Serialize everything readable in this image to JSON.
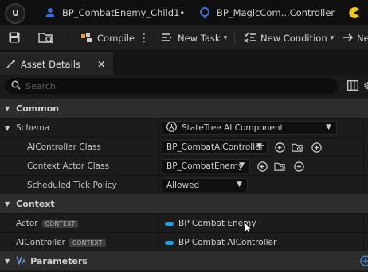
{
  "tabs": [
    {
      "label": "BP_CombatEnemy_Child1•",
      "icon": "person-icon"
    },
    {
      "label": "BP_MagicCom...Controller",
      "icon": "controller-icon"
    }
  ],
  "toolbar": {
    "compile_label": "Compile",
    "new_task_label": "New Task",
    "new_condition_label": "New Condition",
    "cut_label": "Ne"
  },
  "panel": {
    "title": "Asset Details"
  },
  "search": {
    "placeholder": "Search"
  },
  "sections": {
    "common": "Common",
    "context": "Context",
    "parameters": "Parameters"
  },
  "rows": {
    "schema": {
      "label": "Schema",
      "value": "StateTree AI Component"
    },
    "ai_controller_class": {
      "label": "AIController Class",
      "value": "BP_CombatAIController"
    },
    "context_actor_class": {
      "label": "Context Actor Class",
      "value": "BP_CombatEnemy"
    },
    "scheduled_tick_policy": {
      "label": "Scheduled Tick Policy",
      "value": "Allowed"
    },
    "actor": {
      "label": "Actor",
      "badge": "CONTEXT",
      "value": "BP Combat Enemy"
    },
    "ai_controller": {
      "label": "AIController",
      "badge": "CONTEXT",
      "value": "BP Combat AIController"
    }
  },
  "colors": {
    "context_pill": "#1aa3e6",
    "tab_icon_blue": "#3b6fd6",
    "accent_yellow": "#f0c419"
  }
}
